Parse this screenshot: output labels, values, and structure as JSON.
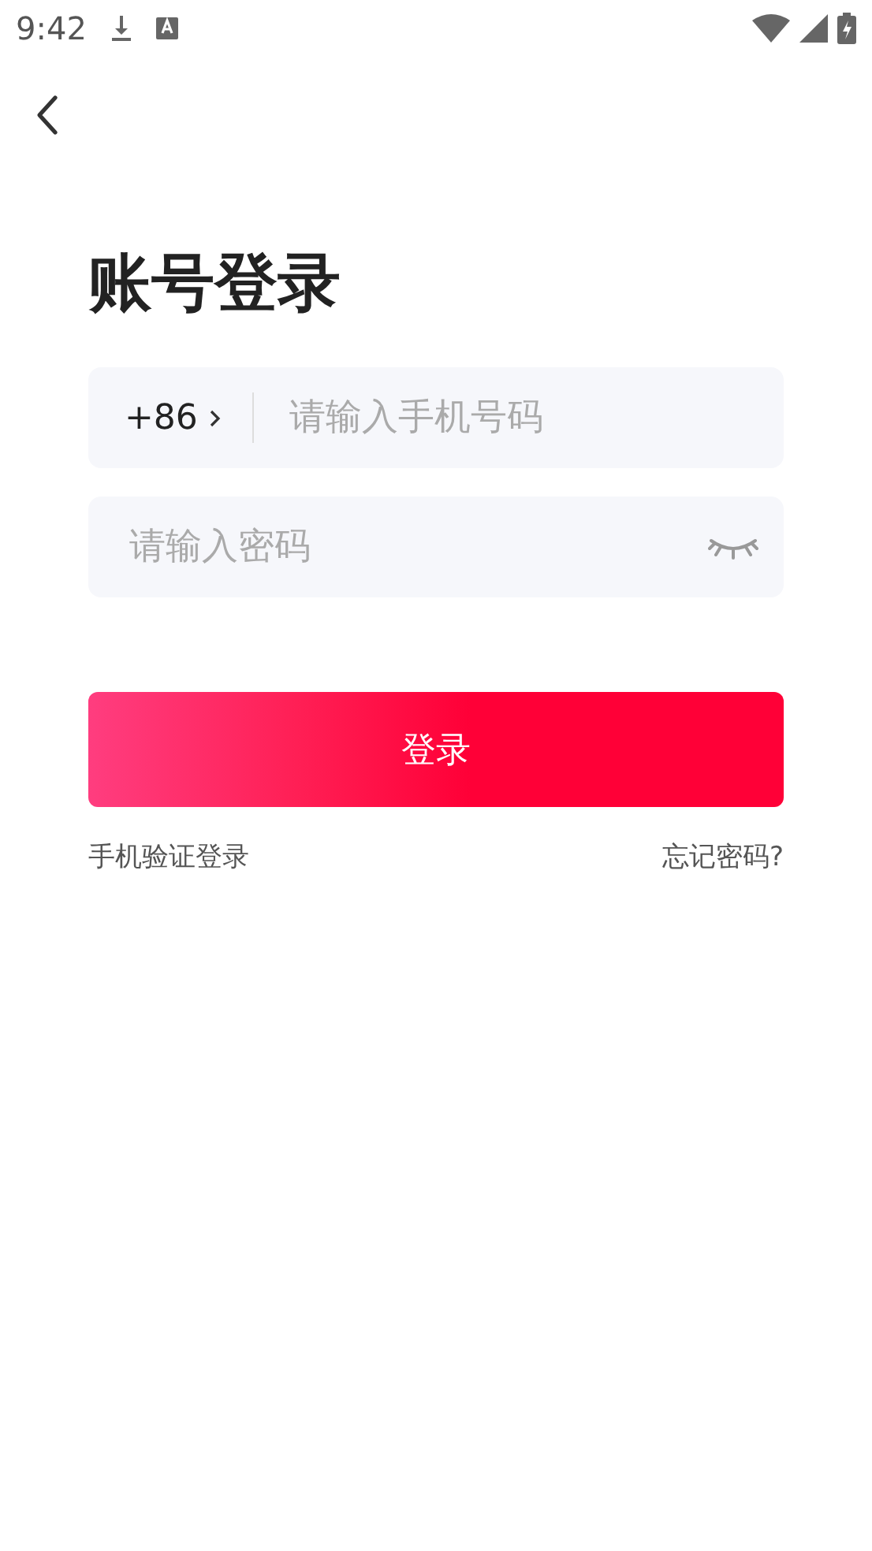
{
  "status_bar": {
    "time": "9:42"
  },
  "title": "账号登录",
  "phone_field": {
    "country_code": "+86",
    "placeholder": "请输入手机号码"
  },
  "password_field": {
    "placeholder": "请输入密码",
    "password_visible": false
  },
  "login_button": "登录",
  "links": {
    "sms_login": "手机验证登录",
    "forgot_password": "忘记密码?"
  }
}
